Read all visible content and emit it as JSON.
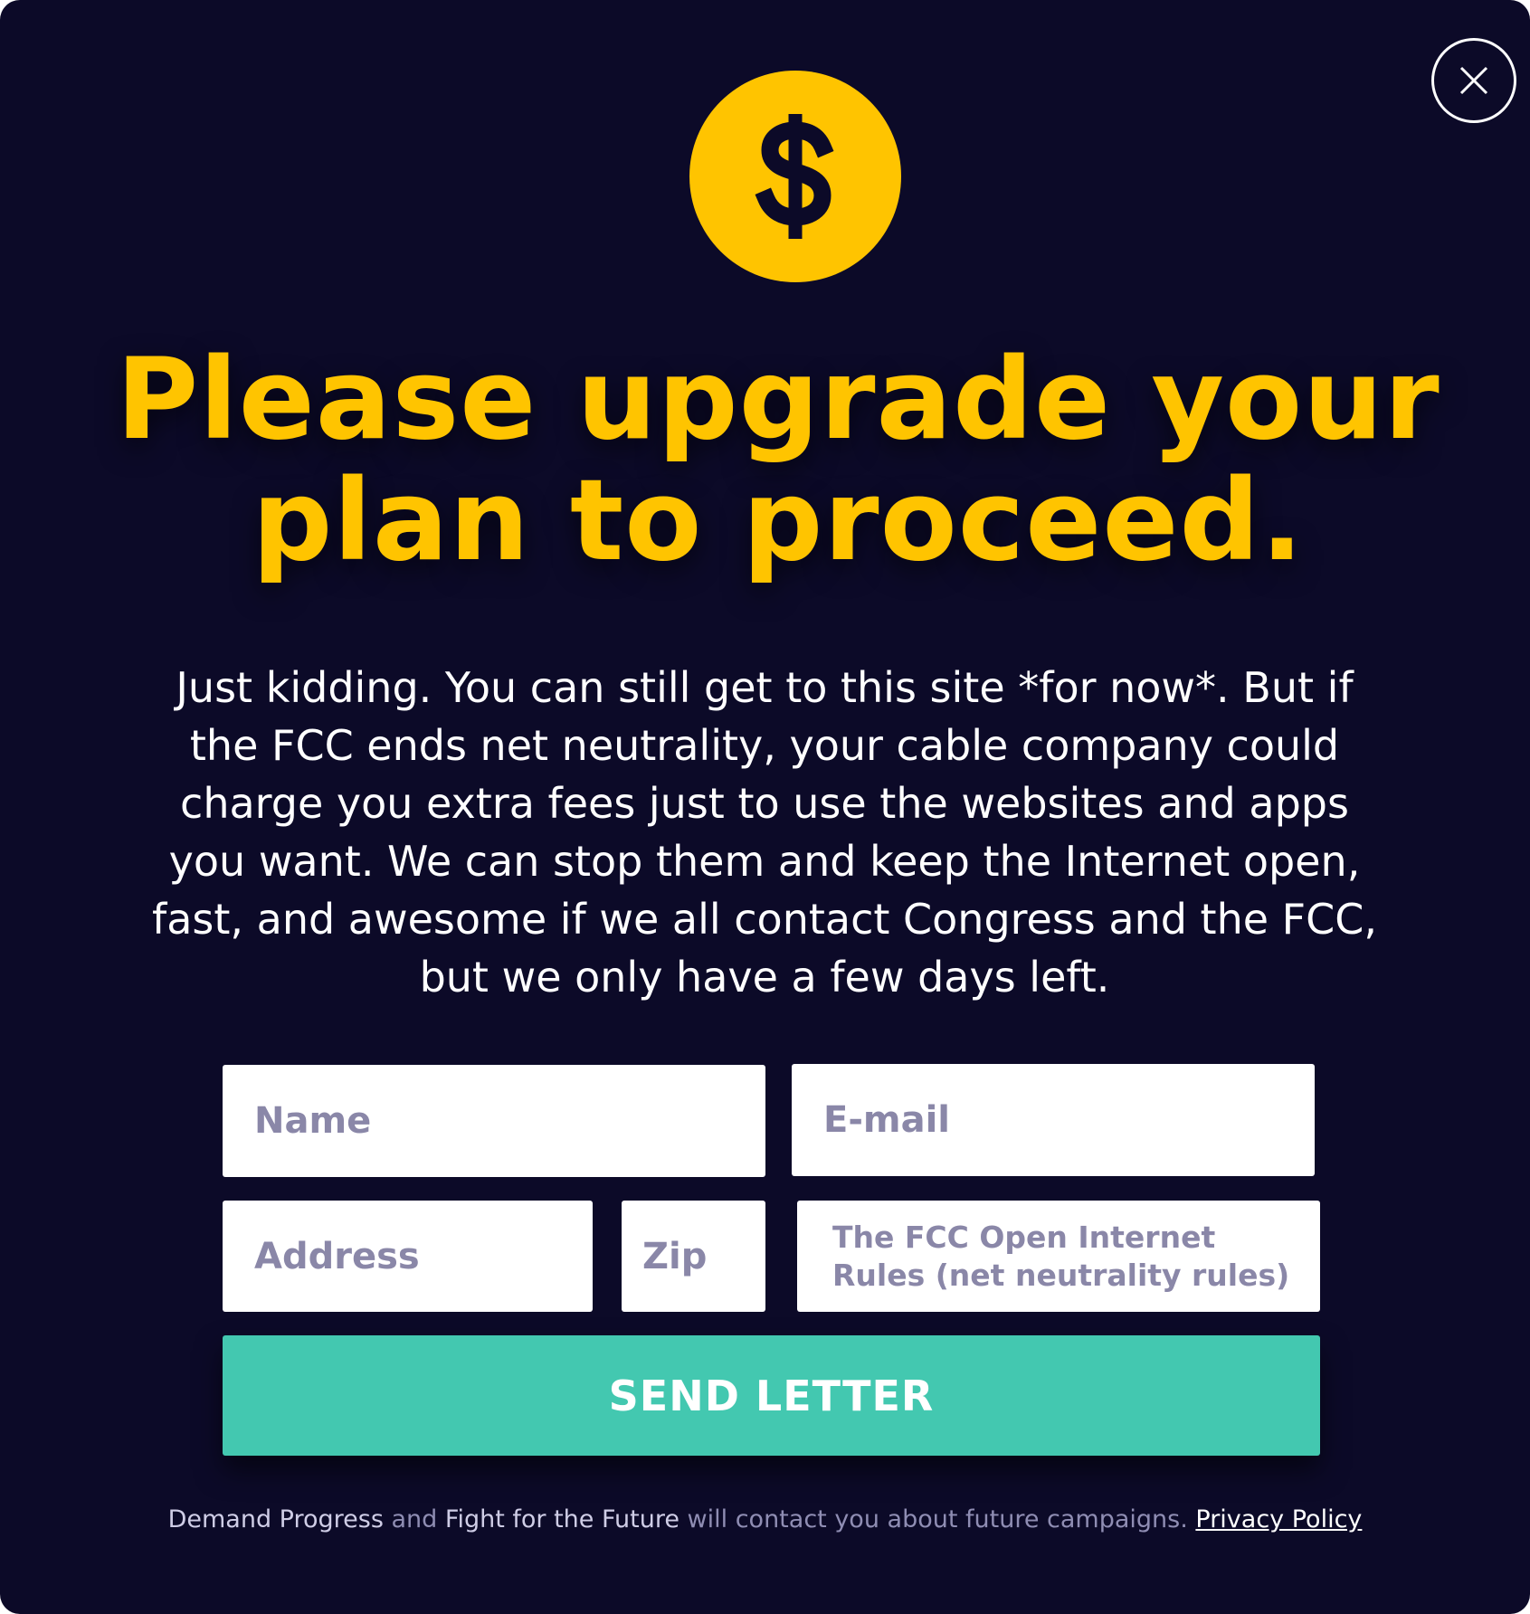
{
  "modal": {
    "close_icon": "close-icon",
    "coin_icon": "dollar-coin-icon",
    "coin_symbol": "$",
    "headline": "Please upgrade your plan to proceed.",
    "body": "Just kidding. You can still get to this site *for now*. But if the FCC ends net neutrality, your cable company could charge you extra fees just to use the websites and apps you want. We can stop them and keep the Internet open, fast, and awesome if we all contact Congress and the FCC, but we only have a few days left."
  },
  "form": {
    "name_placeholder": "Name",
    "email_placeholder": "E-mail",
    "address_placeholder": "Address",
    "zip_placeholder": "Zip",
    "subject_value": "The FCC Open Internet Rules (net neutrality rules)",
    "submit_label": "SEND LETTER"
  },
  "footer": {
    "org1": "Demand Progress",
    "and": " and ",
    "org2": "Fight for the Future",
    "text": "  will contact you about future  campaigns. ",
    "privacy_label": "Privacy Policy"
  },
  "colors": {
    "background": "#0c0a28",
    "accent_yellow": "#ffc400",
    "button_teal": "#43c8b0",
    "placeholder_gray": "#8a87a8"
  }
}
